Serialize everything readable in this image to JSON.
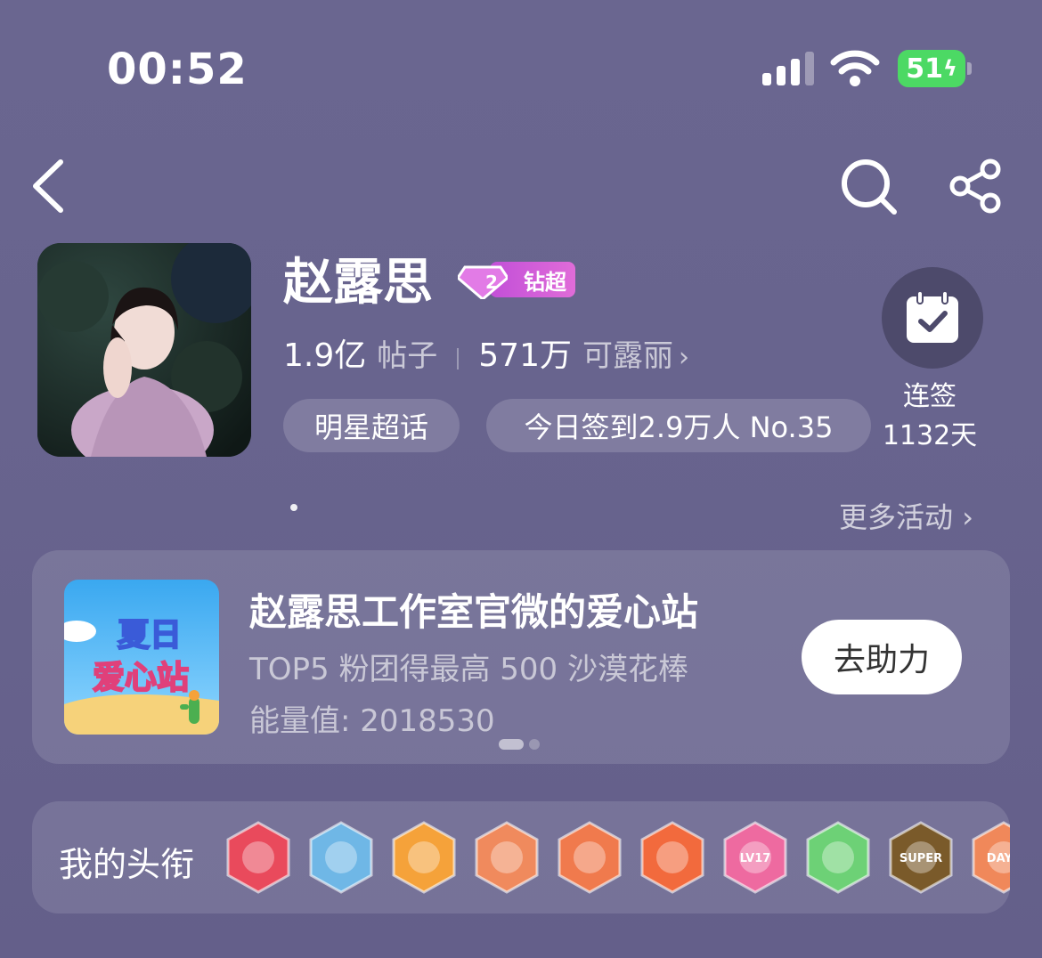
{
  "status_bar": {
    "time": "00:52",
    "battery": "51"
  },
  "profile": {
    "name": "赵露思",
    "level_badge": "钻超",
    "level_number": "2",
    "posts_count": "1.9亿",
    "posts_label": "帖子",
    "fans_count": "571万",
    "fans_label": "可露丽",
    "chip_category": "明星超话",
    "chip_checkin": "今日签到2.9万人 No.35"
  },
  "checkin": {
    "line1": "连签",
    "line2": "1132天"
  },
  "more_activities": "更多活动",
  "activity_card": {
    "thumb_text_1": "夏日",
    "thumb_text_2": "爱心站",
    "title": "赵露思工作室官微的爱心站",
    "subtitle": "TOP5 粉团得最高 500 沙漠花棒",
    "energy": "能量值:  2018530",
    "button": "去助力"
  },
  "titles_section": {
    "label": "我的头衔",
    "medals": [
      {
        "icon": "trophy-medal-icon",
        "color": "#e94a5c"
      },
      {
        "icon": "avatar-medal-icon",
        "color": "#6fb7e6"
      },
      {
        "icon": "crown-medal-icon",
        "color": "#f5a23a"
      },
      {
        "icon": "dragon-medal-icon",
        "color": "#f08a5d"
      },
      {
        "icon": "dragon-medal-icon",
        "color": "#f07a4d"
      },
      {
        "icon": "dragon-medal-icon",
        "color": "#f26a3d"
      },
      {
        "icon": "lv17-medal-icon",
        "color": "#ee6aa0",
        "text": "LV17"
      },
      {
        "icon": "hand-medal-icon",
        "color": "#6dd176"
      },
      {
        "icon": "super-medal-icon",
        "color": "#7a5a2a",
        "text": "SUPER"
      },
      {
        "icon": "days-medal-icon",
        "color": "#f0885a",
        "text": "DAYS"
      }
    ]
  },
  "colors": {
    "background": "#67638d",
    "battery": "#4cd964",
    "badge": "#d05ad8"
  }
}
